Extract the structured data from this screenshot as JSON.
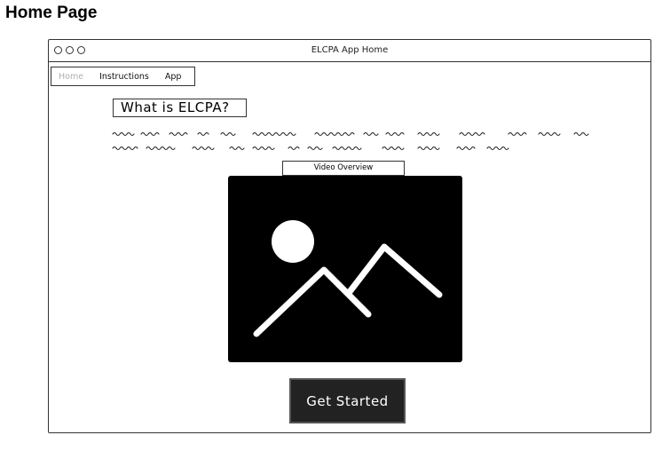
{
  "page": {
    "heading": "Home Page"
  },
  "window": {
    "title": "ELCPA App Home"
  },
  "nav": {
    "items": [
      {
        "label": "Home",
        "active": true
      },
      {
        "label": "Instructions",
        "active": false
      },
      {
        "label": "App",
        "active": false
      }
    ]
  },
  "content": {
    "section_title": "What is ELCPA?",
    "video_label": "Video Overview",
    "cta_label": "Get Started"
  },
  "icons": {
    "video_placeholder": "image-placeholder-icon",
    "window_controls": "window-dot-icon"
  },
  "colors": {
    "video_bg": "#000000",
    "cta_bg": "#222222",
    "cta_text": "#ffffff",
    "nav_active": "#b0b0b0"
  }
}
